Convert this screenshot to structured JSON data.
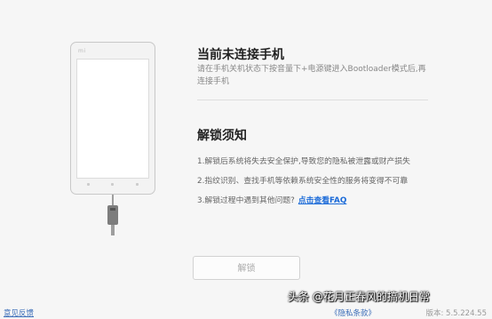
{
  "phone": {
    "logo": "mi"
  },
  "status": {
    "title": "当前未连接手机",
    "description": "请在手机关机状态下按音量下+电源键进入Bootloader模式后,再连接手机"
  },
  "notice": {
    "title": "解锁须知",
    "items": [
      "1.解锁后系统将失去安全保护,导致您的隐私被泄露或财产损失",
      "2.指纹识别、查找手机等依赖系统安全性的服务将变得不可靠",
      "3.解锁过程中遇到其他问题?"
    ],
    "faq_link": "点击查看FAQ"
  },
  "unlock_button": "解锁",
  "footer": {
    "feedback": "意见反馈",
    "privacy": "《隐私条款》",
    "version": "版本: 5.5.224.55"
  },
  "watermark": "头条 @花月正春风的搞机日常"
}
